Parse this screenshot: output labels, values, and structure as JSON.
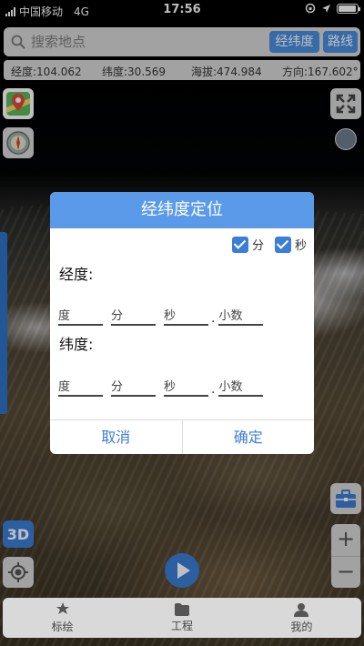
{
  "status": {
    "carrier": "中国移动",
    "network": "4G",
    "time": "17:56",
    "battery_level": 0.95
  },
  "search": {
    "placeholder": "搜索地点",
    "latlng_button": "经纬度",
    "route_button": "路线"
  },
  "info": {
    "longitude": "经度:104.062",
    "latitude": "纬度:30.569",
    "altitude": "海拔:474.984",
    "heading": "方向:167.602°"
  },
  "map_controls": {
    "mode_3d": "3D",
    "zoom_in": "+",
    "zoom_out": "−"
  },
  "dialog": {
    "title": "经纬度定位",
    "check_minutes": "分",
    "check_seconds": "秒",
    "longitude_label": "经度:",
    "latitude_label": "纬度:",
    "fields": {
      "degree": "度",
      "minute": "分",
      "second": "秒",
      "decimal": "小数"
    },
    "decimal_point": ".",
    "cancel": "取消",
    "confirm": "确定"
  },
  "tabs": [
    {
      "label": "标绘",
      "icon": "plot-icon"
    },
    {
      "label": "工程",
      "icon": "folder-icon"
    },
    {
      "label": "我的",
      "icon": "user-icon"
    }
  ],
  "colors": {
    "accent": "#3b7ed8",
    "dialog_header": "#5b9ae8",
    "panel": "#d9d9d9"
  }
}
